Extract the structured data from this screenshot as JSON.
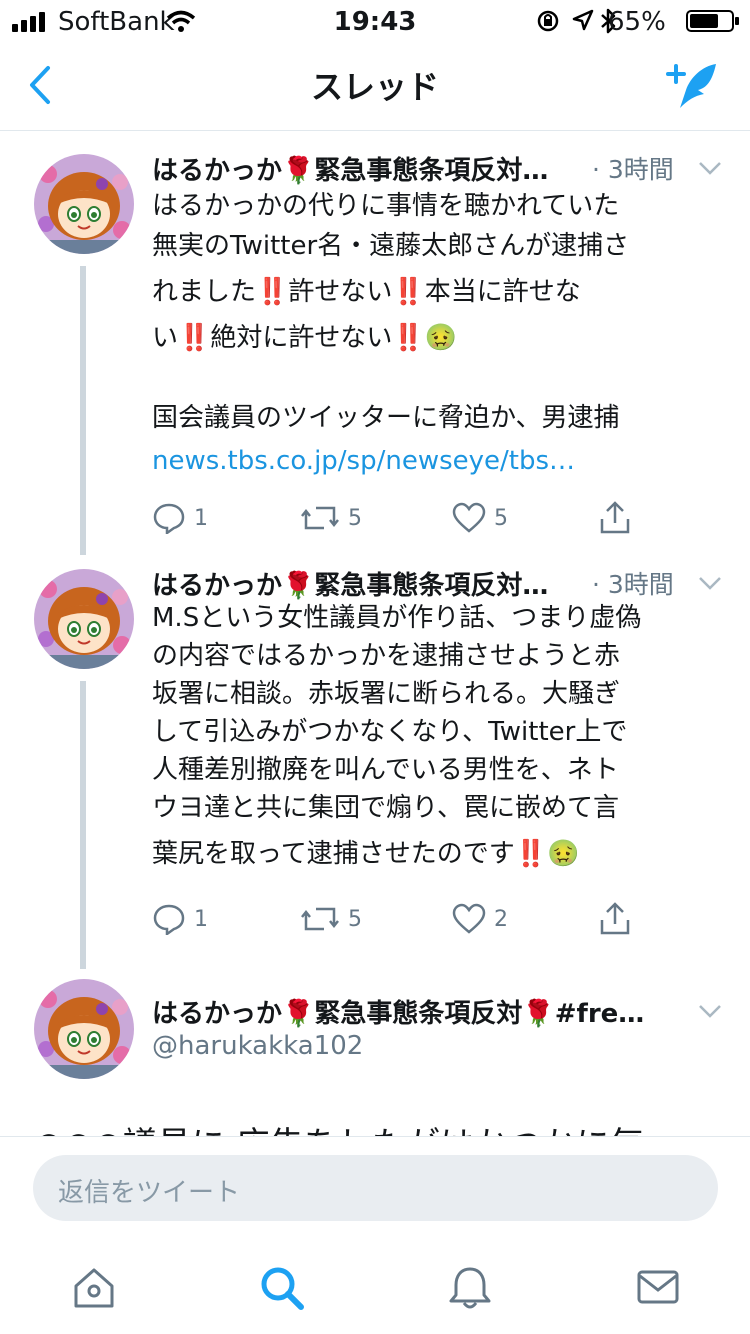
{
  "status_bar": {
    "carrier": "SoftBank",
    "time": "19:43",
    "battery": "65%"
  },
  "nav": {
    "title": "スレッド",
    "back_icon": "chevron-left-icon",
    "compose_icon": "compose-tweet-icon"
  },
  "tweets": [
    {
      "name": "はるかっか🌹緊急事態条項反対…",
      "time": "· 3時間",
      "lines": [
        "はるかっかの代りに事情を聴かれていた",
        "無実のTwitter名・遠藤太郎さんが逮捕さ",
        "れました‼️許せない‼️本当に許せな",
        "い‼️絶対に許せない‼️🤢",
        "",
        "国会議員のツイッターに脅迫か、男逮捕"
      ],
      "link": "news.tbs.co.jp/sp/newseye/tbs…",
      "replies": "1",
      "retweets": "5",
      "likes": "5"
    },
    {
      "name": "はるかっか🌹緊急事態条項反対…",
      "time": "· 3時間",
      "lines": [
        "M.Sという女性議員が作り話、つまり虚偽",
        "の内容ではるかっかを逮捕させようと赤",
        "坂署に相談。赤坂署に断られる。大騒ぎ",
        "して引込みがつかなくなり、Twitter上で",
        "人種差別撤廃を叫んでいる男性を、ネト",
        "ウヨ達と共に集団で煽り、罠に嵌めて言",
        "葉尻を取って逮捕させたのです‼️🤢"
      ],
      "replies": "1",
      "retweets": "5",
      "likes": "2"
    },
    {
      "name": "はるかっか🌹緊急事態条項反対🌹#fre…",
      "handle": "@harukakka102",
      "peek": "○○○議員に 広告をしたがはかつかに気…"
    }
  ],
  "reply": {
    "placeholder": "返信をツイート"
  },
  "tabs": [
    "home-icon",
    "search-icon",
    "notifications-bell-icon",
    "messages-envelope-icon"
  ],
  "colors": {
    "accent": "#1da1f2",
    "link": "#1b95e0",
    "muted": "#657786",
    "thread_line": "#cdd6dd"
  }
}
